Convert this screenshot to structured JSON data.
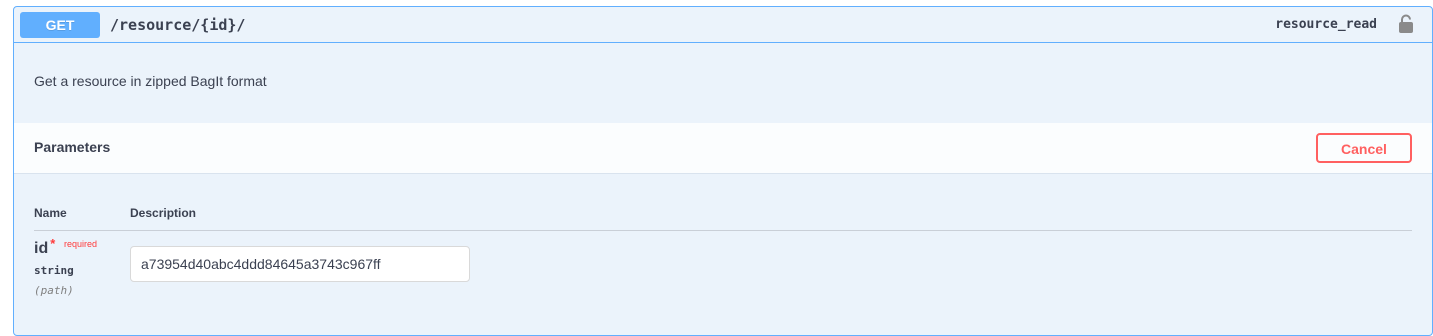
{
  "operation": {
    "method": "GET",
    "path": "/resource/{id}/",
    "operation_id": "resource_read",
    "lock_icon": "lock-icon",
    "description": "Get a resource in zipped BagIt format",
    "color_accent": "#61affe"
  },
  "parameters": {
    "title": "Parameters",
    "cancel_label": "Cancel",
    "columns": {
      "name": "Name",
      "description": "Description"
    },
    "items": [
      {
        "name": "id",
        "required_marker": "*",
        "required_label": "required",
        "type": "string",
        "in": "(path)",
        "value": "a73954d40abc4ddd84645a3743c967ff"
      }
    ]
  }
}
